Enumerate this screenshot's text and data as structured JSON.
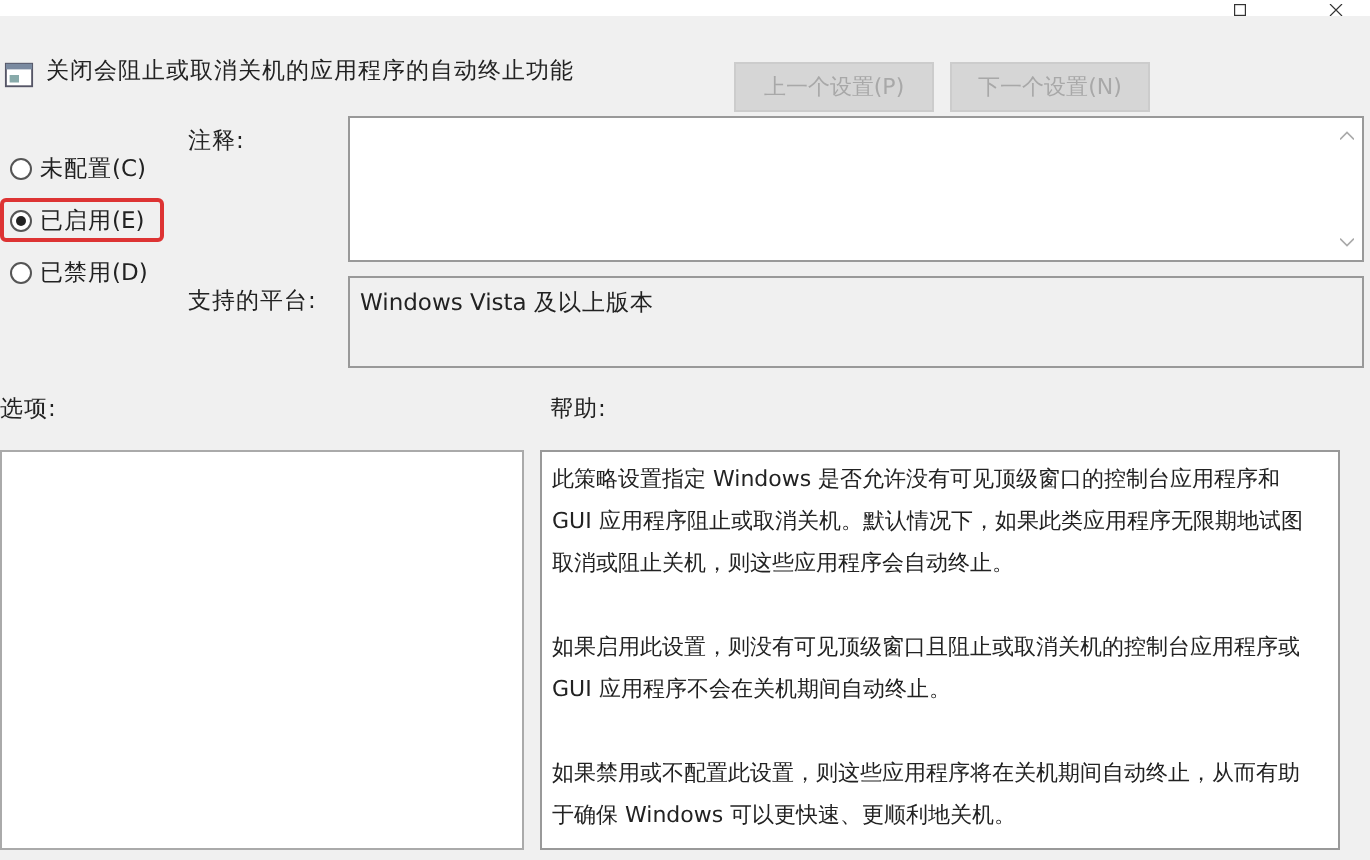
{
  "header": {
    "title": "关闭会阻止或取消关机的应用程序的自动终止功能"
  },
  "nav_buttons": [
    {
      "label": "上一个设置(P)",
      "disabled": true
    },
    {
      "label": "下一个设置(N)",
      "disabled": true
    }
  ],
  "options": [
    {
      "label": "未配置(C)",
      "selected": false,
      "highlighted": false
    },
    {
      "label": "已启用(E)",
      "selected": true,
      "highlighted": true
    },
    {
      "label": "已禁用(D)",
      "selected": false,
      "highlighted": false
    }
  ],
  "comment": {
    "label": "注释:"
  },
  "platform": {
    "label": "支持的平台:",
    "value": "Windows Vista 及以上版本"
  },
  "options_label": "选项:",
  "help_label": "帮助:",
  "help_paragraphs": [
    "此策略设置指定 Windows 是否允许没有可见顶级窗口的控制台应用程序和 GUI 应用程序阻止或取消关机。默认情况下，如果此类应用程序无限期地试图取消或阻止关机，则这些应用程序会自动终止。",
    "如果启用此设置，则没有可见顶级窗口且阻止或取消关机的控制台应用程序或 GUI 应用程序不会在关机期间自动终止。",
    "如果禁用或不配置此设置，则这些应用程序将在关机期间自动终止，从而有助于确保 Windows 可以更快速、更顺利地关机。"
  ]
}
